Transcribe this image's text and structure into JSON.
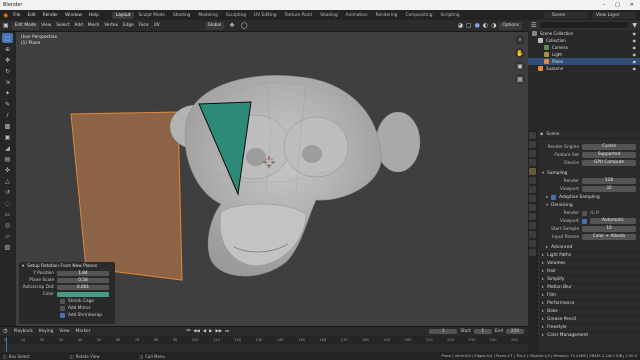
{
  "app": {
    "title": "Blender"
  },
  "menubar": {
    "menus": [
      "File",
      "Edit",
      "Render",
      "Window",
      "Help"
    ],
    "workspaces": [
      "Layout",
      "Sculpt Mode",
      "Shading",
      "Modeling",
      "Sculpting",
      "UV Editing",
      "Texture Paint",
      "Shading",
      "Animation",
      "Rendering",
      "Compositing",
      "Scripting"
    ],
    "scene_label": "Scene",
    "view_layer_label": "View Layer"
  },
  "viewport_header": {
    "mode": "Edit Mode",
    "menus": [
      "View",
      "Select",
      "Add",
      "Mesh",
      "Vertex",
      "Edge",
      "Face",
      "UV"
    ],
    "orientation": "Global",
    "options_label": "Options"
  },
  "viewport": {
    "view_name": "User Perspective",
    "object_name": "(1) Plane"
  },
  "redo_panel": {
    "title": "Setup Rotation From New Planes",
    "fields": [
      {
        "label": "Y Position",
        "value": "1.84"
      },
      {
        "label": "Plane Scale",
        "value": "0.58"
      },
      {
        "label": "Autoscrop Dist",
        "value": "0.001"
      },
      {
        "label": "Color",
        "value": ""
      }
    ],
    "checks": [
      {
        "label": "Shrink Cage",
        "checked": false
      },
      {
        "label": "Add Mirror",
        "checked": false
      },
      {
        "label": "Add Shrinkwrap",
        "checked": true
      }
    ]
  },
  "outliner": {
    "search_placeholder": "",
    "rows": [
      {
        "label": "Scene Collection",
        "indent": 0,
        "color": "#888888",
        "hl": false
      },
      {
        "label": "Collection",
        "indent": 1,
        "color": "#bbbbbb",
        "hl": false
      },
      {
        "label": "Camera",
        "indent": 2,
        "color": "#5d8f4f",
        "hl": false
      },
      {
        "label": "Light",
        "indent": 2,
        "color": "#b48c3a",
        "hl": false
      },
      {
        "label": "Plane",
        "indent": 2,
        "color": "#e08a3c",
        "hl": true
      },
      {
        "label": "Suzanne",
        "indent": 1,
        "color": "#e08a3c",
        "hl": false
      }
    ]
  },
  "properties": {
    "scene_name": "Scene",
    "render_engine": {
      "label": "Render Engine",
      "value": "Cycles"
    },
    "feature_set": {
      "label": "Feature Set",
      "value": "Supported"
    },
    "device": {
      "label": "Device",
      "value": "GPU Compute"
    },
    "sampling_title": "Sampling",
    "render_samples": {
      "label": "Render",
      "value": "128"
    },
    "viewport_samples": {
      "label": "Viewport",
      "value": "32"
    },
    "adaptive_label": "Adaptive Sampling",
    "denoising_title": "Denoising",
    "denoise_render": {
      "label": "Render",
      "value": "NLM"
    },
    "denoise_viewport": {
      "label": "Viewport",
      "value": "Automatic"
    },
    "start_sample": {
      "label": "Start Sample",
      "value": "10"
    },
    "input_passes": {
      "label": "Input Passes",
      "value": "Color + Albedo"
    },
    "advanced_title": "Advanced",
    "sections": [
      "Light Paths",
      "Volumes",
      "Hair",
      "Simplify",
      "Motion Blur",
      "Film",
      "Performance",
      "Bake",
      "Grease Pencil",
      "Freestyle",
      "Color Management"
    ]
  },
  "timeline": {
    "menus": [
      "Playback",
      "Keying",
      "View",
      "Marker"
    ],
    "current_frame": "1",
    "start_label": "Start",
    "start": "1",
    "end_label": "End",
    "end": "250",
    "ticks": [
      "0",
      "10",
      "20",
      "30",
      "40",
      "50",
      "60",
      "70",
      "80",
      "90",
      "100",
      "110",
      "120",
      "130",
      "140",
      "150",
      "160",
      "170",
      "180",
      "190",
      "200",
      "210",
      "220",
      "230",
      "240",
      "250"
    ]
  },
  "statusbar": {
    "left": [
      "Box Select",
      "Rotate View",
      "Call Menu"
    ],
    "right": "Plane | Verts:4/4 | Edges:4/4 | Faces:1/1 | Tris:2 | Objects:1/4 | Memory: 73.4 MiB | VRAM: 2.1/8.0 GiB | 2.90.0"
  }
}
